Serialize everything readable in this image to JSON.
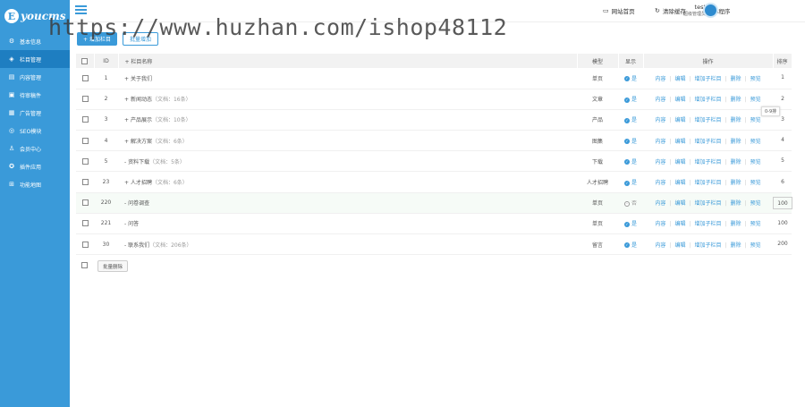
{
  "brand": {
    "logo_letter": "E",
    "logo_text": "youcms"
  },
  "sidebar": {
    "items": [
      {
        "label": "基本信息",
        "icon": "gear-icon",
        "glyph": "⚙"
      },
      {
        "label": "栏目管理",
        "icon": "layers-icon",
        "glyph": "◈"
      },
      {
        "label": "内容管理",
        "icon": "document-icon",
        "glyph": "▤"
      },
      {
        "label": "待审稿件",
        "icon": "audit-icon",
        "glyph": "▣"
      },
      {
        "label": "广告管理",
        "icon": "ad-icon",
        "glyph": "▦"
      },
      {
        "label": "SEO模块",
        "icon": "seo-icon",
        "glyph": "◎"
      },
      {
        "label": "会员中心",
        "icon": "user-icon",
        "glyph": "♙"
      },
      {
        "label": "插件应用",
        "icon": "plugin-icon",
        "glyph": "✪"
      },
      {
        "label": "功能地图",
        "icon": "map-icon",
        "glyph": "⊞"
      }
    ]
  },
  "topbar": {
    "site_home": "网站首页",
    "site_home_icon": "monitor-icon",
    "clear_cache": "清除缓存",
    "clear_cache_icon": "refresh-icon",
    "mini_program": "小程序",
    "mini_program_icon": "miniprogram-icon",
    "username": "test",
    "role": "超级管理员"
  },
  "watermark": "https://www.huzhan.com/ishop48112",
  "toolbar": {
    "add_label": "+ 增加栏目",
    "batch_label": "批量增加"
  },
  "table": {
    "headers": {
      "id": "ID",
      "name": "+ 栏目名称",
      "model": "模型",
      "display": "显示",
      "ops": "操作",
      "sort": "排序"
    },
    "rows": [
      {
        "id": "1",
        "prefix": "+",
        "name": "关于我们",
        "sub": "",
        "model": "单页",
        "display": "是",
        "shown": true,
        "sort": "1"
      },
      {
        "id": "2",
        "prefix": "+",
        "name": "新闻动态",
        "sub": "（文档：16条）",
        "model": "文章",
        "display": "是",
        "shown": true,
        "sort": "2"
      },
      {
        "id": "3",
        "prefix": "+",
        "name": "产品展示",
        "sub": "（文档：10条）",
        "model": "产品",
        "display": "是",
        "shown": true,
        "sort": "3"
      },
      {
        "id": "4",
        "prefix": "+",
        "name": "解决方案",
        "sub": "（文档：6条）",
        "model": "图集",
        "display": "是",
        "shown": true,
        "sort": "4"
      },
      {
        "id": "5",
        "prefix": "-",
        "name": "资料下载",
        "sub": "（文档：5条）",
        "model": "下载",
        "display": "是",
        "shown": true,
        "sort": "5"
      },
      {
        "id": "23",
        "prefix": "+",
        "name": "人才招聘",
        "sub": "（文档：6条）",
        "model": "人才招聘",
        "display": "是",
        "shown": true,
        "sort": "6"
      },
      {
        "id": "220",
        "prefix": "-",
        "name": "问卷调查",
        "sub": "",
        "model": "单页",
        "display": "否",
        "shown": false,
        "sort": "100"
      },
      {
        "id": "221",
        "prefix": "-",
        "name": "问答",
        "sub": "",
        "model": "单页",
        "display": "是",
        "shown": true,
        "sort": "100"
      },
      {
        "id": "30",
        "prefix": "-",
        "name": "联系我们",
        "sub": "（文档：206条）",
        "model": "留言",
        "display": "是",
        "shown": true,
        "sort": "200"
      }
    ],
    "ops": [
      "内容",
      "编辑",
      "增加子栏目",
      "删除",
      "预览"
    ]
  },
  "tooltip": "0-9排",
  "footer": {
    "batch_delete": "批量删除"
  }
}
